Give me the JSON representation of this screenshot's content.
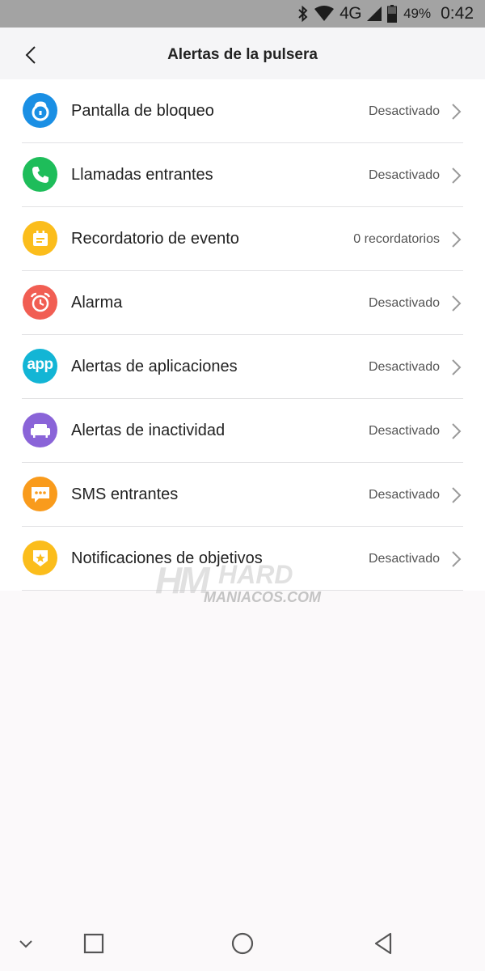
{
  "status_bar": {
    "network": "4G",
    "battery": "49%",
    "time": "0:42"
  },
  "header": {
    "title": "Alertas de la pulsera"
  },
  "items": [
    {
      "label": "Pantalla de bloqueo",
      "value": "Desactivado",
      "icon": "lock-icon",
      "color": "#1a8fe4"
    },
    {
      "label": "Llamadas entrantes",
      "value": "Desactivado",
      "icon": "phone-icon",
      "color": "#1ebd5a"
    },
    {
      "label": "Recordatorio de evento",
      "value": "0 recordatorios",
      "icon": "calendar-icon",
      "color": "#fbbd1c"
    },
    {
      "label": "Alarma",
      "value": "Desactivado",
      "icon": "alarm-clock-icon",
      "color": "#f15e53"
    },
    {
      "label": "Alertas de aplicaciones",
      "value": "Desactivado",
      "icon": "app-icon",
      "icon_text": "app",
      "color": "#13b5d5"
    },
    {
      "label": "Alertas de inactividad",
      "value": "Desactivado",
      "icon": "sofa-icon",
      "color": "#8a64d8"
    },
    {
      "label": "SMS entrantes",
      "value": "Desactivado",
      "icon": "sms-icon",
      "color": "#f99b1c"
    },
    {
      "label": "Notificaciones de objetivos",
      "value": "Desactivado",
      "icon": "goal-badge-icon",
      "color": "#fbbd1c"
    }
  ],
  "watermark": {
    "line1": "HM",
    "line2": "HARD",
    "line3": "MANIACOS.COM"
  }
}
